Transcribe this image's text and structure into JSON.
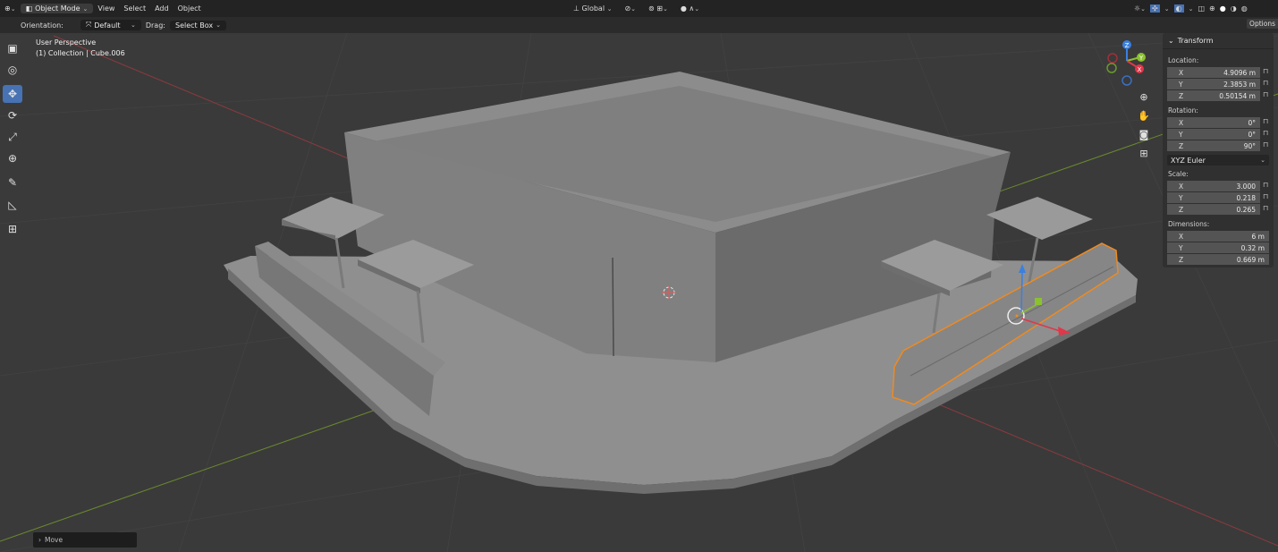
{
  "header": {
    "editor_icon": "globe-icon",
    "mode": "Object Mode",
    "menus": [
      "View",
      "Select",
      "Add",
      "Object"
    ],
    "transform_space": "Global"
  },
  "toolbar": {
    "orientation_label": "Orientation:",
    "orientation_value": "Default",
    "drag_label": "Drag:",
    "drag_value": "Select Box",
    "options": "Options"
  },
  "viewport": {
    "view_name": "User Perspective",
    "collection_info": "(1) Collection | Cube.006"
  },
  "tools": [
    {
      "name": "select-box-tool",
      "icon": "▣",
      "active": false
    },
    {
      "name": "cursor-tool",
      "icon": "◎",
      "active": false
    },
    {
      "name": "move-tool",
      "icon": "✥",
      "active": true
    },
    {
      "name": "rotate-tool",
      "icon": "⟳",
      "active": false
    },
    {
      "name": "scale-tool",
      "icon": "⤢",
      "active": false
    },
    {
      "name": "transform-tool",
      "icon": "⊕",
      "active": false
    },
    {
      "name": "annotate-tool",
      "icon": "✎",
      "active": false
    },
    {
      "name": "measure-tool",
      "icon": "📐",
      "active": false
    },
    {
      "name": "add-cube-tool",
      "icon": "⊞",
      "active": false
    }
  ],
  "gizmo": {
    "z": "Z",
    "y": "Y",
    "x": "X"
  },
  "transform_panel": {
    "title": "Transform",
    "location_label": "Location:",
    "location": [
      {
        "axis": "X",
        "value": "4.9096 m"
      },
      {
        "axis": "Y",
        "value": "2.3853 m"
      },
      {
        "axis": "Z",
        "value": "0.50154 m"
      }
    ],
    "rotation_label": "Rotation:",
    "rotation": [
      {
        "axis": "X",
        "value": "0°"
      },
      {
        "axis": "Y",
        "value": "0°"
      },
      {
        "axis": "Z",
        "value": "90°"
      }
    ],
    "rotation_mode": "XYZ Euler",
    "scale_label": "Scale:",
    "scale": [
      {
        "axis": "X",
        "value": "3.000"
      },
      {
        "axis": "Y",
        "value": "0.218"
      },
      {
        "axis": "Z",
        "value": "0.265"
      }
    ],
    "dimensions_label": "Dimensions:",
    "dimensions": [
      {
        "axis": "X",
        "value": "6 m"
      },
      {
        "axis": "Y",
        "value": "0.32 m"
      },
      {
        "axis": "Z",
        "value": "0.669 m"
      }
    ]
  },
  "last_operator": "Move",
  "colors": {
    "selection_outline": "#f08a1e",
    "active_tool": "#4772b3",
    "x_axis": "#e0374a",
    "y_axis": "#8bc12f",
    "z_axis": "#3b7fe0"
  }
}
